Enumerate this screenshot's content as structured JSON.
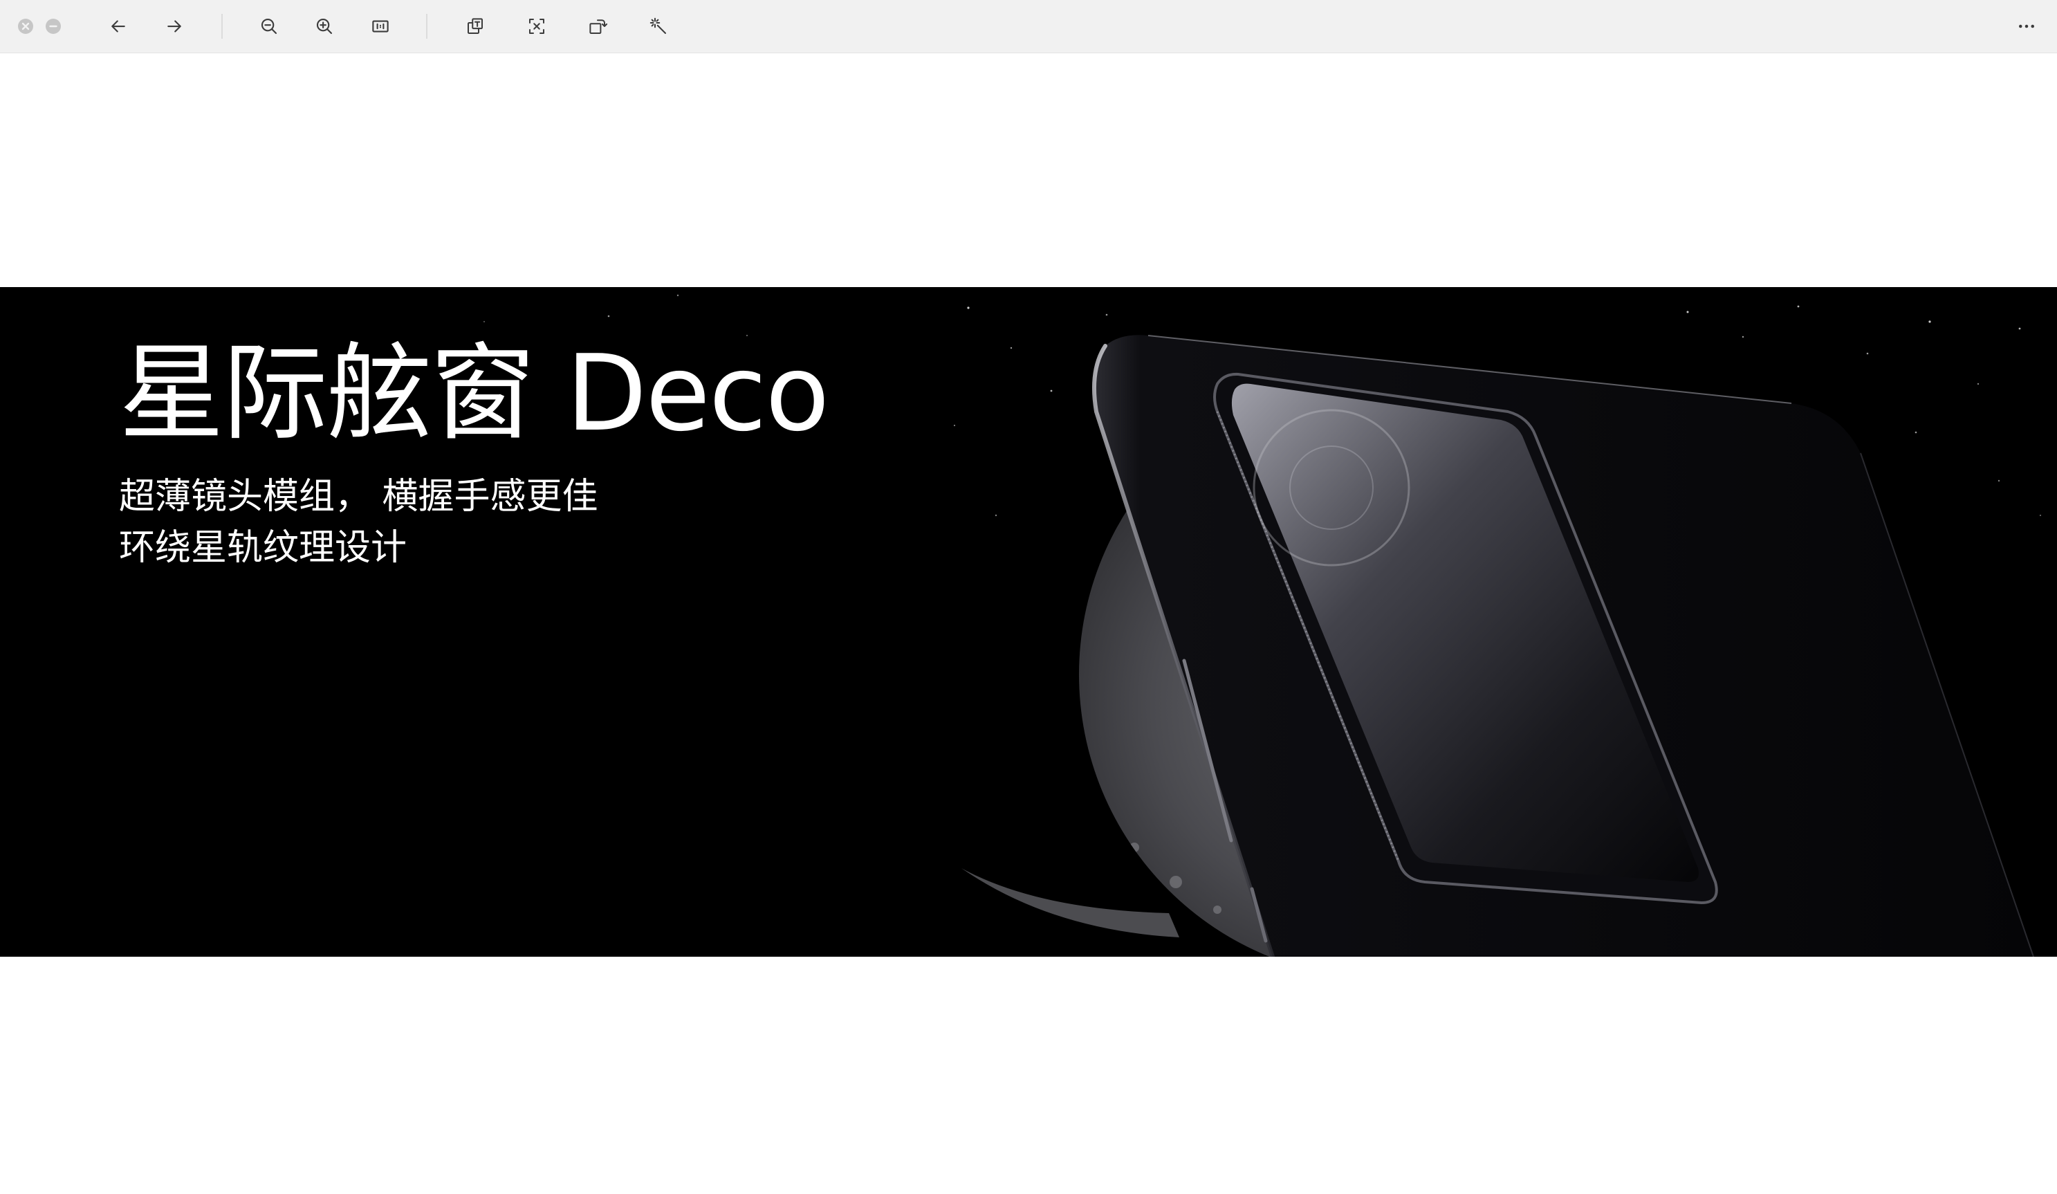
{
  "viewer": {
    "toolbar": {
      "window_buttons": [
        "close-icon",
        "minimize-icon"
      ],
      "tools": [
        "arrow-left-icon",
        "arrow-right-icon",
        "zoom-out-icon",
        "zoom-in-icon",
        "fit-to-window-icon",
        "copy-text-icon",
        "extract-text-icon",
        "rotate-icon",
        "magic-wand-icon",
        "more-options-icon"
      ]
    }
  },
  "image": {
    "headline": "星际舷窗 Deco",
    "subline_1": "超薄镜头模组， 横握手感更佳",
    "subline_2": "环绕星轨纹理设计"
  },
  "colors": {
    "toolbar_bg": "#f1f1f1",
    "icon": "#3c3c3c",
    "banner_bg": "#000000",
    "text": "#ffffff"
  }
}
